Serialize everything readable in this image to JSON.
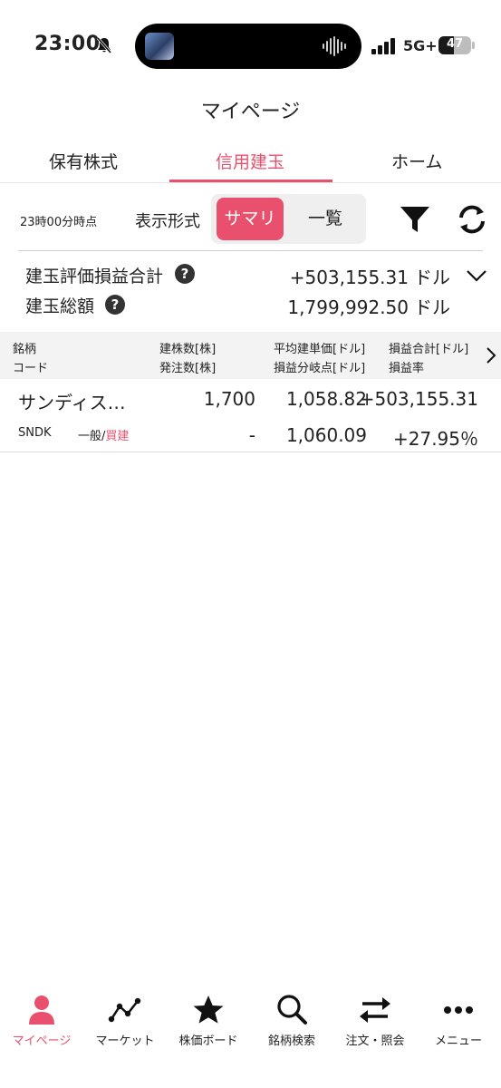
{
  "status_bar": {
    "time": "23:00",
    "network": "5G+",
    "battery": "47",
    "battery_level": 0.47
  },
  "header": {
    "title": "マイページ"
  },
  "tabs": [
    {
      "label": "保有株式",
      "active": false
    },
    {
      "label": "信用建玉",
      "active": true
    },
    {
      "label": "ホーム",
      "active": false
    }
  ],
  "toolbar": {
    "as_of": "23時00分時点",
    "format_label": "表示形式",
    "segment": {
      "summary": "サマリ",
      "list": "一覧"
    }
  },
  "summary": {
    "pl_label": "建玉評価損益合計",
    "pl_value": "+503,155.31",
    "pl_unit": "ドル",
    "total_label": "建玉総額",
    "total_value": "1,799,992.50",
    "total_unit": "ドル"
  },
  "table": {
    "headers": {
      "col1_top": "銘柄",
      "col1_bottom": "コード",
      "col2_top": "建株数[株]",
      "col2_bottom": "発注数[株]",
      "col3_top": "平均建単価[ドル]",
      "col3_bottom": "損益分岐点[ドル]",
      "col4_top": "損益合計[ドル]",
      "col4_bottom": "損益率"
    },
    "rows": [
      {
        "name": "サンディス…",
        "shares": "1,700",
        "avg_price": "1,058.82",
        "pl_total": "+503,155.31",
        "code": "SNDK",
        "account": "一般/",
        "side": "買建",
        "order_qty": "-",
        "breakeven": "1,060.09",
        "pl_rate": "+27.95％"
      }
    ]
  },
  "bottom_nav": [
    {
      "label": "マイページ",
      "icon": "person-icon",
      "active": true
    },
    {
      "label": "マーケット",
      "icon": "line-chart-icon",
      "active": false
    },
    {
      "label": "株価ボード",
      "icon": "star-icon",
      "active": false
    },
    {
      "label": "銘柄検索",
      "icon": "search-icon",
      "active": false
    },
    {
      "label": "注文・照会",
      "icon": "swap-arrows-icon",
      "active": false
    },
    {
      "label": "メニュー",
      "icon": "more-dots-icon",
      "active": false
    }
  ],
  "colors": {
    "accent": "#e8506e",
    "text": "#222222",
    "header_bg": "#f3f3f3"
  }
}
